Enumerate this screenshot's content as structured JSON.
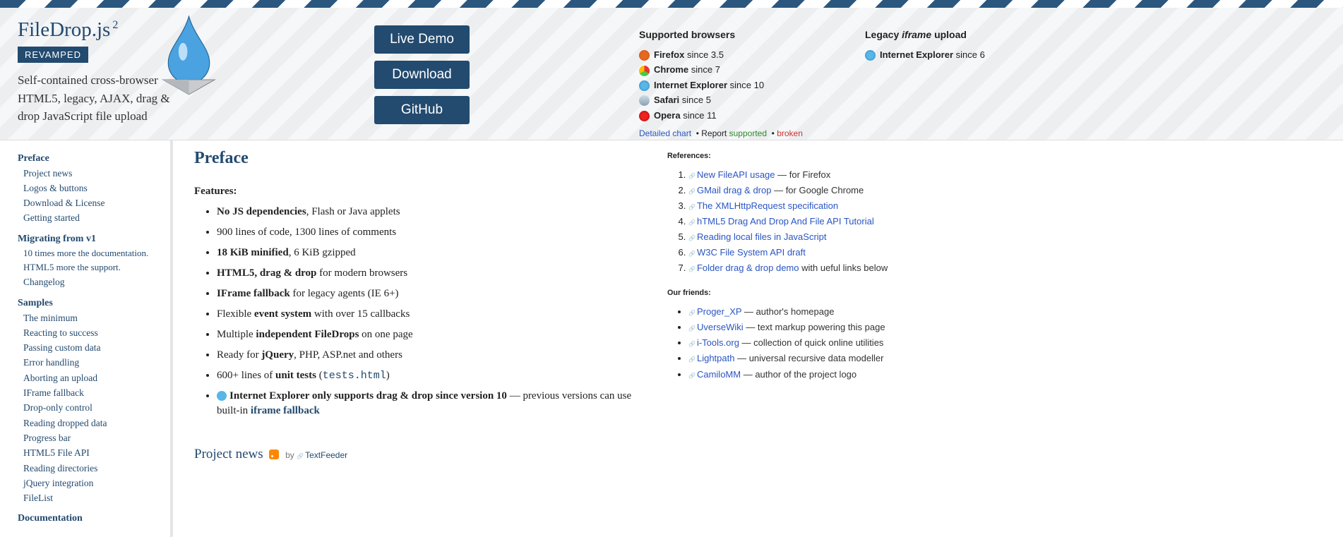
{
  "header": {
    "title": "FileDrop.js",
    "superscript": "2",
    "badge": "REVAMPED",
    "tagline": "Self-contained cross-browser HTML5, legacy, AJAX, drag & drop JavaScript file upload",
    "ctas": {
      "demo": "Live Demo",
      "download": "Download",
      "github": "GitHub"
    },
    "supportedTitle": "Supported browsers",
    "supported": [
      {
        "cls": "ff",
        "name": "Firefox",
        "since": "since 3.5"
      },
      {
        "cls": "ch",
        "name": "Chrome",
        "since": "since 7"
      },
      {
        "cls": "ie",
        "name": "Internet Explorer",
        "since": "since 10"
      },
      {
        "cls": "sf",
        "name": "Safari",
        "since": "since 5"
      },
      {
        "cls": "op",
        "name": "Opera",
        "since": "since 11"
      }
    ],
    "detailed": "Detailed chart",
    "report": "Report",
    "ok": "supported",
    "bad": "broken",
    "legacyTitle": "Legacy",
    "legacyEm": "iframe",
    "legacyTitle2": "upload",
    "legacy": [
      {
        "cls": "ie",
        "name": "Internet Explorer",
        "since": "since 6"
      }
    ]
  },
  "sidebar": [
    {
      "h": "Preface",
      "items": [
        {
          "t": "Project news"
        },
        {
          "t": "Logos & buttons"
        },
        {
          "t": "Download & License"
        },
        {
          "t": "Getting started"
        }
      ]
    },
    {
      "h": "Migrating from v1",
      "items": [
        {
          "blurb": "10 times more the documentation. HTML5 more the support."
        },
        {
          "t": "Changelog"
        }
      ]
    },
    {
      "h": "Samples",
      "items": [
        {
          "t": "The minimum"
        },
        {
          "t": "Reacting to success"
        },
        {
          "t": "Passing custom data"
        },
        {
          "t": "Error handling"
        },
        {
          "t": "Aborting an upload"
        },
        {
          "t": "IFrame fallback"
        },
        {
          "t": "Drop-only control"
        },
        {
          "t": "Reading dropped data"
        },
        {
          "t": "Progress bar"
        },
        {
          "t": "HTML5 File API"
        },
        {
          "t": "Reading directories"
        },
        {
          "t": "jQuery integration"
        },
        {
          "t": "FileList"
        }
      ]
    },
    {
      "h": "Documentation",
      "items": []
    }
  ],
  "main": {
    "title": "Preface",
    "featuresLabel": "Features:",
    "features": [
      {
        "html": "<b>No JS dependencies</b>, Flash or Java applets"
      },
      {
        "html": "900 lines of code, 1300 lines of comments"
      },
      {
        "html": "<b>18 KiB minified</b>, 6 KiB gzipped"
      },
      {
        "html": "<b>HTML5, drag &amp; drop</b> for modern browsers"
      },
      {
        "html": "<b>IFrame fallback</b> for legacy agents (IE 6+)"
      },
      {
        "html": "Flexible <b>event system</b> with over 15 callbacks"
      },
      {
        "html": "Multiple <b>independent FileDrops</b> on one page"
      },
      {
        "html": "Ready for <b>jQuery</b>, PHP, ASP.net and others"
      },
      {
        "html": "600+ lines of <b>unit tests</b> (<a href='#'><code>tests.html</code></a>)"
      },
      {
        "html": "<span class='ieicon'></span><b>Internet Explorer only supports drag &amp; drop since version 10</b> — previous versions can use built-in <b><a href='#'>iframe fallback</a></b>"
      }
    ],
    "news": {
      "title": "Project news",
      "by": "by",
      "feeder": "TextFeeder"
    }
  },
  "refs": {
    "title": "References:",
    "items": [
      {
        "t": "New FileAPI usage",
        "tail": " — for Firefox"
      },
      {
        "t": "GMail drag & drop",
        "tail": " — for Google Chrome"
      },
      {
        "t": "The XMLHttpRequest specification",
        "tail": ""
      },
      {
        "t": "hTML5 Drag And Drop And File API Tutorial",
        "tail": ""
      },
      {
        "t": "Reading local files in JavaScript",
        "tail": ""
      },
      {
        "t": "W3C File System API draft",
        "tail": ""
      },
      {
        "t": "Folder drag & drop demo",
        "tail": " with ueful links below"
      }
    ],
    "friendsTitle": "Our friends:",
    "friends": [
      {
        "t": "Proger_XP",
        "tail": " — author's homepage"
      },
      {
        "t": "UverseWiki",
        "tail": " — text markup powering this page"
      },
      {
        "t": "i-Tools.org",
        "tail": " — collection of quick online utilities"
      },
      {
        "t": "Lightpath",
        "tail": " — universal recursive data modeller"
      },
      {
        "t": "CamiloMM",
        "tail": " — author of the project logo"
      }
    ]
  }
}
